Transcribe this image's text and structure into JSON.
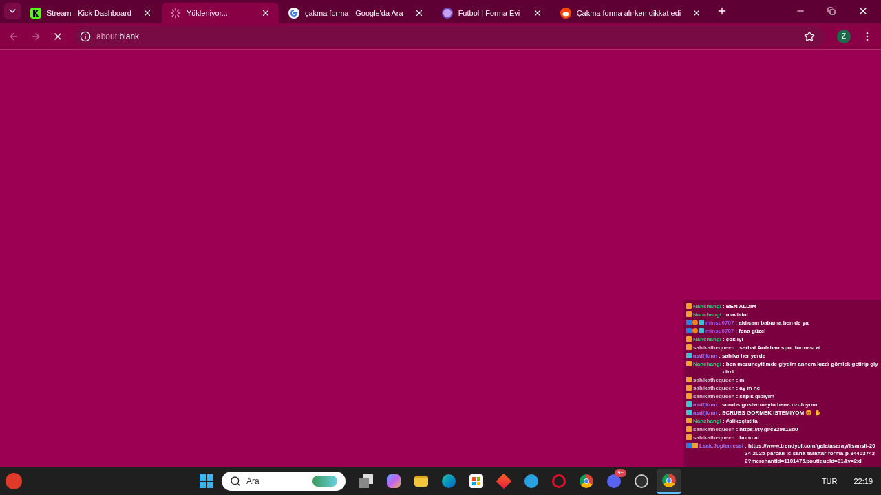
{
  "tabs": [
    {
      "title": "Stream - Kick Dashboard",
      "kind": "kick",
      "selected": false
    },
    {
      "title": "Yükleniyor...",
      "kind": "spinner",
      "selected": true
    },
    {
      "title": "çakma forma - Google'da Ara",
      "kind": "google",
      "selected": false
    },
    {
      "title": "Futbol | Forma Evi",
      "kind": "site",
      "selected": false
    },
    {
      "title": "Çakma forma alırken dikkat edi",
      "kind": "reddit",
      "selected": false
    }
  ],
  "toolbar": {
    "url_scheme": "about:",
    "url_rest": "blank",
    "loading": true,
    "profile": "Z"
  },
  "chat": [
    {
      "badges": [
        {
          "kind": "sub"
        }
      ],
      "user": "Nanchangi",
      "color": "#3ec47a",
      "text": ": BEN ALDIM"
    },
    {
      "badges": [
        {
          "kind": "sub"
        }
      ],
      "user": "Nanchangi",
      "color": "#3ec47a",
      "text": ": mavisini"
    },
    {
      "badges": [
        {
          "kind": "mod"
        },
        {
          "kind": "gift"
        },
        {
          "kind": "og"
        }
      ],
      "user": "minsu0707",
      "color": "#9b5cf0",
      "text": ": aldıcam babama ben de ya"
    },
    {
      "badges": [
        {
          "kind": "mod"
        },
        {
          "kind": "gift"
        },
        {
          "kind": "og"
        }
      ],
      "user": "minsu0707",
      "color": "#9b5cf0",
      "text": ": fena güzel"
    },
    {
      "badges": [
        {
          "kind": "sub"
        }
      ],
      "user": "Nanchangi",
      "color": "#3ec47a",
      "text": ": çok iyi"
    },
    {
      "badges": [
        {
          "kind": "sub"
        }
      ],
      "user": "sahikathequeen",
      "color": "#d8c4cf",
      "text": ": serhat Ardahan spor forması al"
    },
    {
      "badges": [
        {
          "kind": "og"
        }
      ],
      "user": "asdfjkmn",
      "color": "#a07cf0",
      "text": ": sahika her yerde"
    },
    {
      "badges": [
        {
          "kind": "sub"
        }
      ],
      "user": "Nanchangi",
      "color": "#3ec47a",
      "text": ": ben mezuneyitimde giydim annem kızdı gömlek getirip giydirdi"
    },
    {
      "badges": [
        {
          "kind": "sub"
        }
      ],
      "user": "sahikathequeen",
      "color": "#d8c4cf",
      "text": ": m"
    },
    {
      "badges": [
        {
          "kind": "sub"
        }
      ],
      "user": "sahikathequeen",
      "color": "#d8c4cf",
      "text": ": ay m ne"
    },
    {
      "badges": [
        {
          "kind": "sub"
        }
      ],
      "user": "sahikathequeen",
      "color": "#d8c4cf",
      "text": ": sapık gibiyim"
    },
    {
      "badges": [
        {
          "kind": "og"
        }
      ],
      "user": "asdfjkmn",
      "color": "#a07cf0",
      "text": ": scrubs gostwrmeyin bana uzuluyom"
    },
    {
      "badges": [
        {
          "kind": "og"
        }
      ],
      "user": "asdfjkmn",
      "color": "#a07cf0",
      "text": ": SCRUBS GORMEK ISTEMIYOM 😡 ✋"
    },
    {
      "badges": [
        {
          "kind": "sub"
        }
      ],
      "user": "Nanchangi",
      "color": "#3ec47a",
      "text": ": #alikoçistifa"
    },
    {
      "badges": [
        {
          "kind": "sub"
        }
      ],
      "user": "sahikathequeen",
      "color": "#d8c4cf",
      "text": ": https://ty.gl/c329a16d0"
    },
    {
      "badges": [
        {
          "kind": "sub"
        }
      ],
      "user": "sahikathequeen",
      "color": "#d8c4cf",
      "text": ": bunu al"
    },
    {
      "badges": [
        {
          "kind": "mod"
        },
        {
          "kind": "sub"
        }
      ],
      "user": "Lsak.Joplemessi",
      "color": "#a07cf0",
      "text": ": https://www.trendyol.com/galatasaray/lisansli-2024-2025-parcali-ic-saha-taraftar-forma-p-844037432?merchantId=110147&boutiqueId=61&v=2xl"
    }
  ],
  "taskbar": {
    "search_placeholder": "Ara",
    "apps": [
      {
        "kind": "taskview",
        "active": false
      },
      {
        "kind": "copilot",
        "active": false
      },
      {
        "kind": "files",
        "active": false
      },
      {
        "kind": "edge",
        "active": false
      },
      {
        "kind": "store",
        "active": false
      },
      {
        "kind": "diamond",
        "active": false
      },
      {
        "kind": "help",
        "active": false
      },
      {
        "kind": "opera",
        "active": false
      },
      {
        "kind": "chrome",
        "active": false
      },
      {
        "kind": "discord",
        "badge": "9+",
        "active": false
      },
      {
        "kind": "obs",
        "active": false
      },
      {
        "kind": "chrome",
        "active": true
      }
    ],
    "language": "TUR",
    "time": "22:19"
  }
}
